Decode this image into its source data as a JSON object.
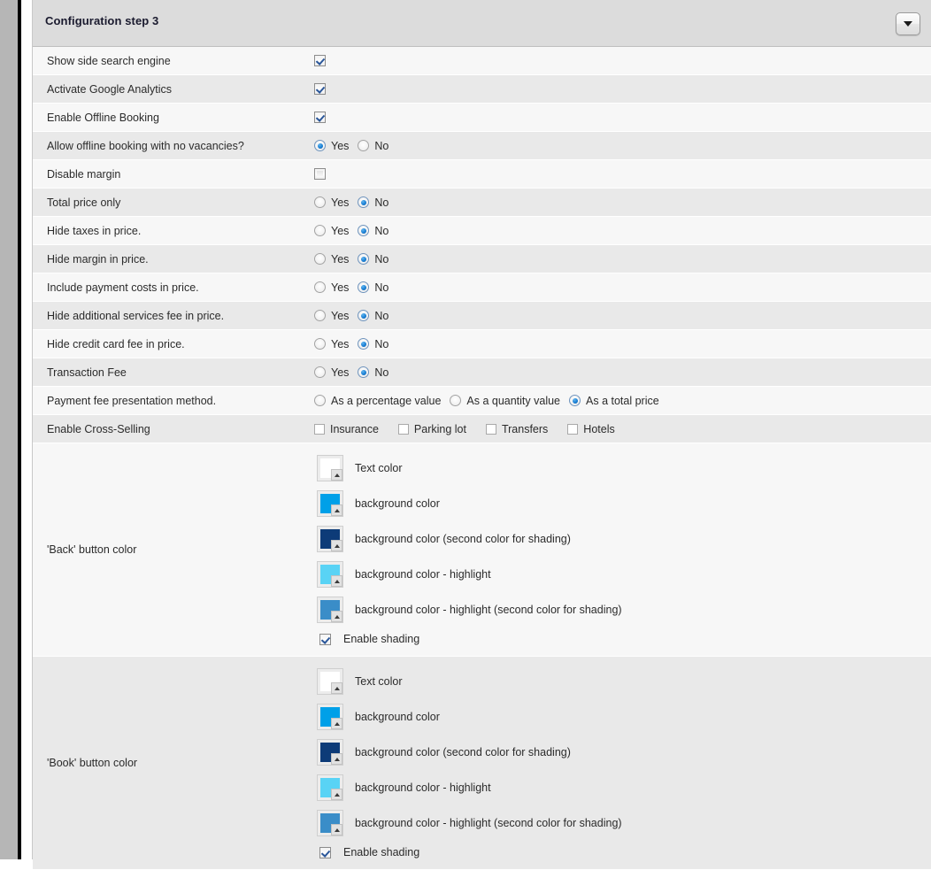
{
  "window": {
    "left_chrome": {
      "scrollbar_color": "#b6b6b6",
      "rule_color": "#000000"
    }
  },
  "header": {
    "title": "Configuration step 3",
    "toggle_icon": "chevron-down-icon"
  },
  "rows": [
    {
      "type": "checkbox",
      "label": "Show side search engine",
      "checked": true,
      "style": "classic"
    },
    {
      "type": "checkbox",
      "label": "Activate Google Analytics",
      "checked": true,
      "style": "classic"
    },
    {
      "type": "checkbox",
      "label": "Enable Offline Booking",
      "checked": true,
      "style": "classic"
    },
    {
      "type": "radio",
      "label": "Allow offline booking with no vacancies?",
      "options": [
        "Yes",
        "No"
      ],
      "selected": "Yes"
    },
    {
      "type": "checkbox",
      "label": "Disable margin",
      "checked": false,
      "style": "classic"
    },
    {
      "type": "radio",
      "label": "Total price only",
      "options": [
        "Yes",
        "No"
      ],
      "selected": "No"
    },
    {
      "type": "radio",
      "label": "Hide taxes in price.",
      "options": [
        "Yes",
        "No"
      ],
      "selected": "No"
    },
    {
      "type": "radio",
      "label": "Hide margin in price.",
      "options": [
        "Yes",
        "No"
      ],
      "selected": "No"
    },
    {
      "type": "radio",
      "label": "Include payment costs in price.",
      "options": [
        "Yes",
        "No"
      ],
      "selected": "No"
    },
    {
      "type": "radio",
      "label": "Hide additional services fee in price.",
      "options": [
        "Yes",
        "No"
      ],
      "selected": "No"
    },
    {
      "type": "radio",
      "label": "Hide credit card fee in price.",
      "options": [
        "Yes",
        "No"
      ],
      "selected": "No"
    },
    {
      "type": "radio",
      "label": "Transaction Fee",
      "options": [
        "Yes",
        "No"
      ],
      "selected": "No"
    },
    {
      "type": "radio",
      "label": "Payment fee presentation method.",
      "options": [
        "As a percentage value",
        "As a quantity value",
        "As a total price"
      ],
      "selected": "As a total price"
    },
    {
      "type": "checkgroup",
      "label": "Enable Cross-Selling",
      "options": [
        {
          "label": "Insurance",
          "checked": false
        },
        {
          "label": "Parking lot",
          "checked": false
        },
        {
          "label": "Transfers",
          "checked": false
        },
        {
          "label": "Hotels",
          "checked": false
        }
      ]
    }
  ],
  "color_sections": [
    {
      "label": "'Back' button color",
      "colors": [
        {
          "caption": "Text color",
          "value": "#ffffff"
        },
        {
          "caption": "background color",
          "value": "#00a0e8"
        },
        {
          "caption": "background color (second color for shading)",
          "value": "#0d3b78"
        },
        {
          "caption": "background color - highlight",
          "value": "#59d3f5"
        },
        {
          "caption": "background color - highlight (second color for shading)",
          "value": "#3a8dc8"
        }
      ],
      "shading": {
        "label": "Enable shading",
        "checked": true
      }
    },
    {
      "label": "'Book' button color",
      "colors": [
        {
          "caption": "Text color",
          "value": "#ffffff"
        },
        {
          "caption": "background color",
          "value": "#00a0e8"
        },
        {
          "caption": "background color (second color for shading)",
          "value": "#0d3b78"
        },
        {
          "caption": "background color - highlight",
          "value": "#59d3f5"
        },
        {
          "caption": "background color - highlight (second color for shading)",
          "value": "#3a8dc8"
        }
      ],
      "shading": {
        "label": "Enable shading",
        "checked": true
      }
    }
  ]
}
